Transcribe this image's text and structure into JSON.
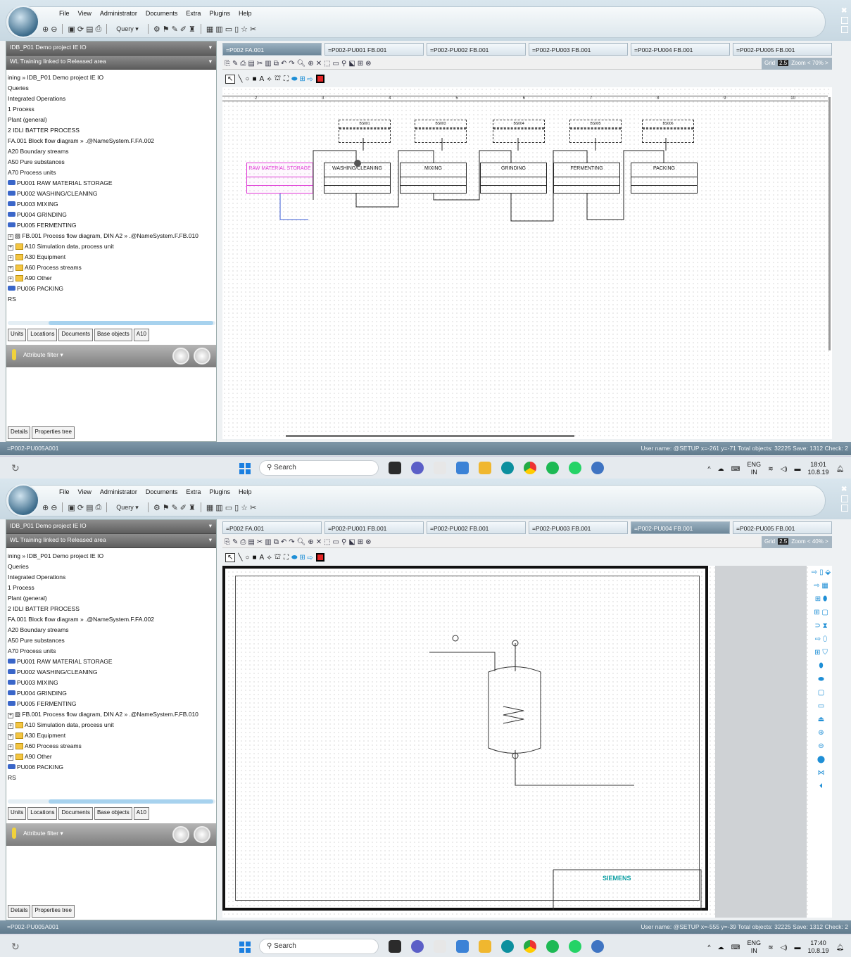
{
  "menu": [
    "File",
    "View",
    "Administrator",
    "Documents",
    "Extra",
    "Plugins",
    "Help"
  ],
  "query_label": "Query",
  "project_combo": "IDB_P01  Demo project IE IO",
  "wl_combo": "WL  Training linked to Released area",
  "tree": [
    "ining  »  IDB_P01   Demo project IE IO",
    "Queries",
    "Integrated Operations",
    "1   Process",
    "Plant (general)",
    "2   IDLI BATTER PROCESS",
    "FA.001  Block flow diagram  »  .@NameSystem.F.FA.002",
    "A20   Boundary streams",
    "A50   Pure substances",
    "A70   Process units",
    "PU001   RAW MATERIAL STORAGE",
    "PU002   WASHING/CLEANING",
    "PU003   MIXING",
    "PU004   GRINDING",
    "PU005   FERMENTING",
    "FB.001   Process flow diagram, DIN A2  »  .@NameSystem.F.FB.010",
    "A10   Simulation data, process unit",
    "A30   Equipment",
    "A60   Process streams",
    "A90   Other",
    "PU006   PACKING",
    "RS"
  ],
  "left_tabs": [
    "Units",
    "Locations",
    "Documents",
    "Base objects",
    "A10"
  ],
  "attribute_filter": "Attribute filter",
  "bottom_tabs": [
    "Details",
    "Properties tree"
  ],
  "doc_tabs": [
    "=P002  FA.001",
    "=P002-PU001  FB.001",
    "=P002-PU002  FB.001",
    "=P002-PU003  FB.001",
    "=P002-PU004  FB.001",
    "=P002-PU005  FB.001"
  ],
  "grid_label": "Grid",
  "grid_value": "2.5",
  "ruler": [
    "2",
    "3",
    "4",
    "5",
    "6",
    "7",
    "8",
    "9",
    "10"
  ],
  "units": [
    "RAW MATERIAL STORAGE",
    "WASHING/CLEANING",
    "MIXING",
    "GRINDING",
    "FERMENTING",
    "PACKING"
  ],
  "tags": [
    "BS001",
    "BS003",
    "BS004",
    "BS005",
    "BS006"
  ],
  "siemens": "SIEMENS",
  "taskbar_search": "Search",
  "lang": "ENG",
  "lang2": "IN",
  "date": "10.8.19",
  "shots": [
    {
      "zoom": "Zoom  <  70%  >",
      "active_tab": 0,
      "status_left": "=P002-PU005A001",
      "status_right": "User name:  @SETUP   x=-261 y=-71  Total objects: 32225   Save: 1312   Check: 2",
      "time": "18:01"
    },
    {
      "zoom": "Zoom  <  40%  >",
      "active_tab": 4,
      "status_left": "=P002-PU005A001",
      "status_right": "User name:  @SETUP   x=-555 y=-39  Total objects: 32225   Save: 1312   Check: 2",
      "time": "17:40"
    }
  ]
}
